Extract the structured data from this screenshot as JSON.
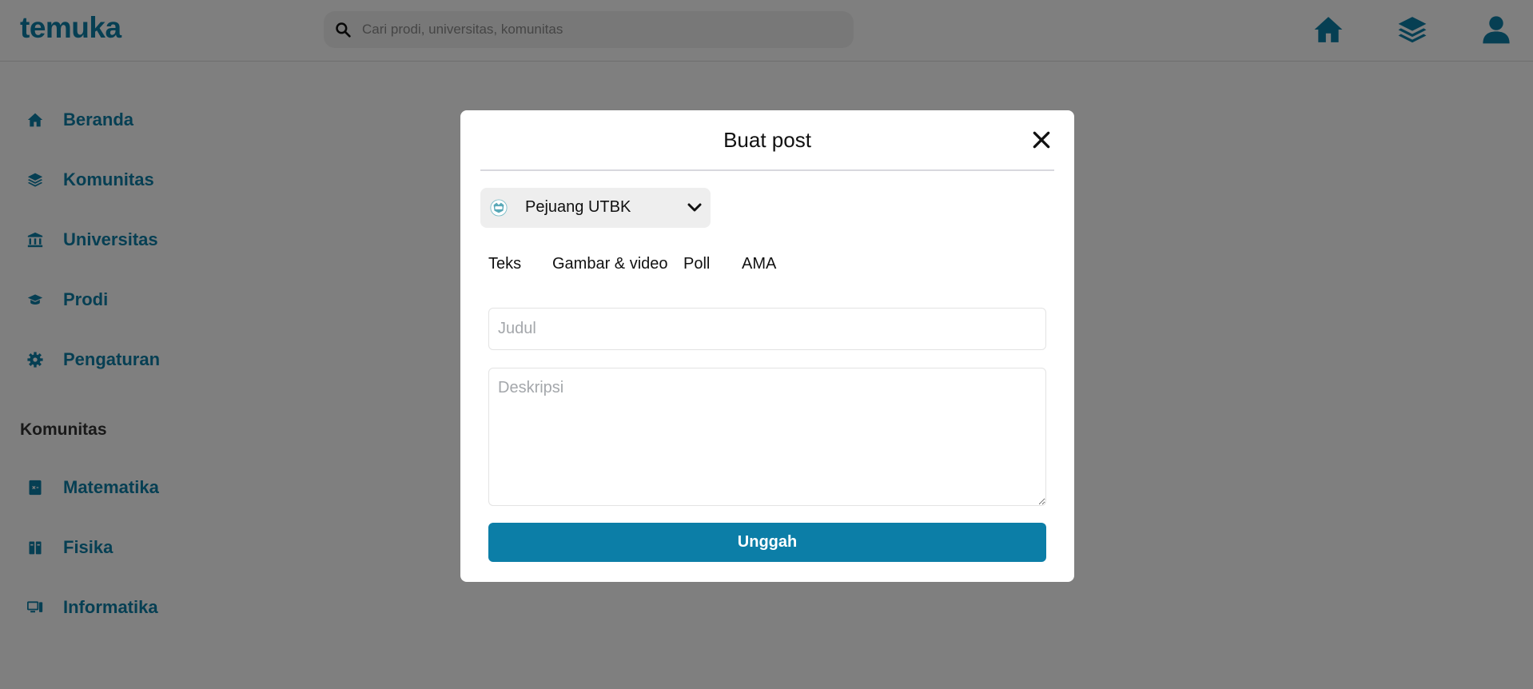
{
  "app": {
    "logo": "temuka",
    "brand_color": "#0c7ea7"
  },
  "header": {
    "search": {
      "placeholder": "Cari prodi, universitas, komunitas",
      "value": ""
    },
    "icons": [
      "home-icon",
      "layers-icon",
      "user-icon"
    ]
  },
  "sidebar": {
    "items": [
      {
        "label": "Beranda",
        "icon": "home-icon"
      },
      {
        "label": "Komunitas",
        "icon": "layers-icon"
      },
      {
        "label": "Universitas",
        "icon": "university-icon"
      },
      {
        "label": "Prodi",
        "icon": "graduation-cap-icon"
      },
      {
        "label": "Pengaturan",
        "icon": "gear-icon"
      }
    ],
    "communities_title": "Komunitas",
    "communities": [
      {
        "label": "Matematika",
        "icon": "math-book-icon"
      },
      {
        "label": "Fisika",
        "icon": "atom-book-icon"
      },
      {
        "label": "Informatika",
        "icon": "computer-icon"
      }
    ]
  },
  "modal": {
    "title": "Buat post",
    "community": {
      "selected": "Pejuang UTBK",
      "icon": "community-avatar-icon"
    },
    "tabs": [
      "Teks",
      "Gambar & video",
      "Poll",
      "AMA"
    ],
    "title_field": {
      "placeholder": "Judul",
      "value": ""
    },
    "description_field": {
      "placeholder": "Deskripsi",
      "value": ""
    },
    "submit_label": "Unggah"
  }
}
